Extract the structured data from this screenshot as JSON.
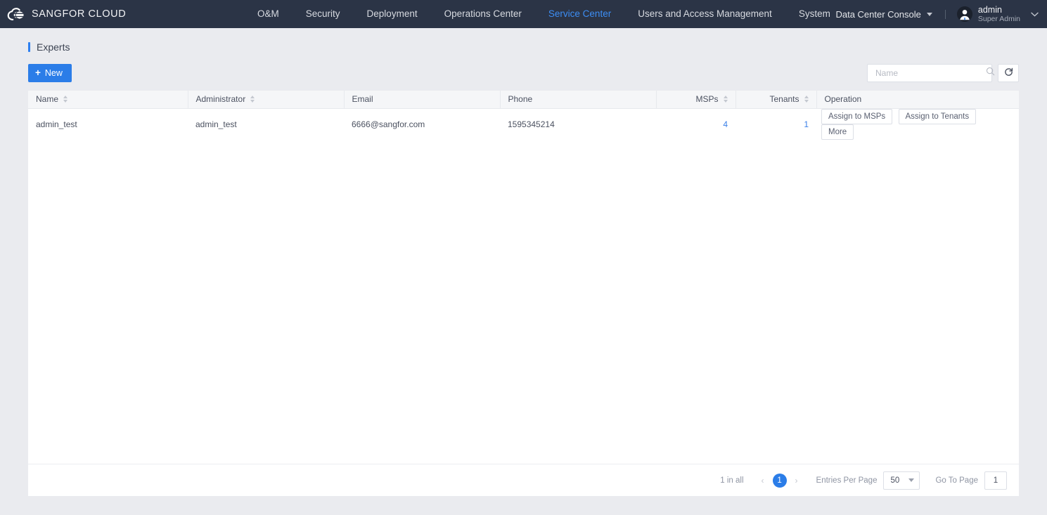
{
  "header": {
    "brand": "SANGFOR CLOUD",
    "brand_logo_icon": "cloud-sphere-logo-icon",
    "nav": [
      {
        "label": "O&M",
        "active": false
      },
      {
        "label": "Security",
        "active": false
      },
      {
        "label": "Deployment",
        "active": false
      },
      {
        "label": "Operations Center",
        "active": false
      },
      {
        "label": "Service Center",
        "active": true
      },
      {
        "label": "Users and Access Management",
        "active": false
      },
      {
        "label": "System",
        "active": false
      }
    ],
    "console_selector": "Data Center Console",
    "console_caret_icon": "caret-down-icon",
    "user": {
      "name": "admin",
      "role": "Super Admin",
      "avatar_icon": "user-avatar-icon",
      "chevron_icon": "chevron-down-icon"
    }
  },
  "page": {
    "title": "Experts"
  },
  "toolbar": {
    "new_label": "New",
    "new_icon": "plus-icon",
    "search_placeholder": "Name",
    "search_value": "",
    "search_icon": "search-icon",
    "refresh_icon": "refresh-icon"
  },
  "table": {
    "columns": [
      {
        "label": "Name",
        "sortable": true,
        "align": "left"
      },
      {
        "label": "Administrator",
        "sortable": true,
        "align": "left"
      },
      {
        "label": "Email",
        "sortable": false,
        "align": "left"
      },
      {
        "label": "Phone",
        "sortable": false,
        "align": "left"
      },
      {
        "label": "MSPs",
        "sortable": true,
        "align": "right"
      },
      {
        "label": "Tenants",
        "sortable": true,
        "align": "right"
      },
      {
        "label": "Operation",
        "sortable": false,
        "align": "left"
      }
    ],
    "rows": [
      {
        "name": "admin_test",
        "administrator": "admin_test",
        "email": "6666@sangfor.com",
        "phone": "1595345214",
        "msps": "4",
        "tenants": "1",
        "operations": [
          "Assign to MSPs",
          "Assign to Tenants",
          "More"
        ]
      }
    ]
  },
  "pagination": {
    "total_text": "1 in all",
    "prev_icon": "chevron-left-icon",
    "next_icon": "chevron-right-icon",
    "current_page": "1",
    "entries_per_page_label": "Entries Per Page",
    "entries_per_page_value": "50",
    "entries_caret_icon": "caret-down-icon",
    "go_to_page_label": "Go To Page",
    "go_to_page_value": "1"
  },
  "colors": {
    "header_bg": "#2b3446",
    "accent_blue": "#2b7de8",
    "nav_active": "#3d8ef5",
    "page_bg": "#eaebef",
    "link_blue": "#3a7fe8"
  }
}
